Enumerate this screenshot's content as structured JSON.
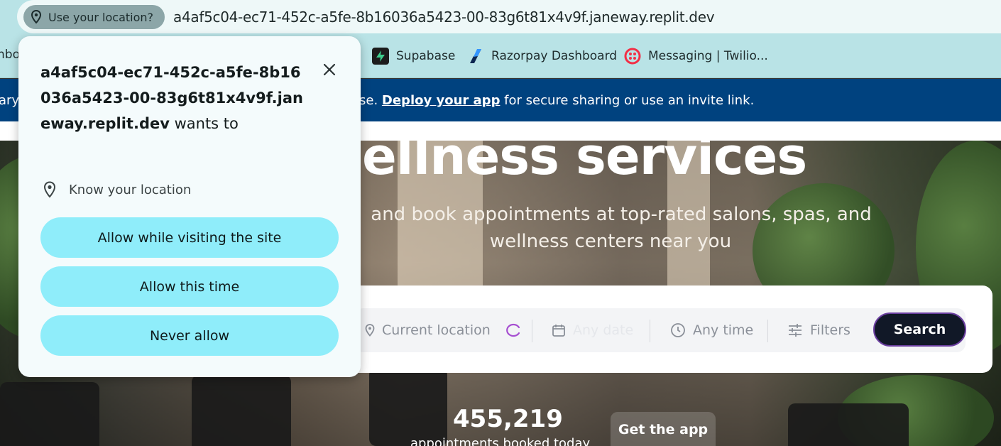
{
  "address_bar": {
    "location_chip_label": "Use your location?",
    "url": "a4af5c04-ec71-452c-a5fe-8b16036a5423-00-83g6t81x4v9f.janeway.replit.dev"
  },
  "bookmarks": {
    "cut_item": "nbo",
    "items": [
      {
        "label": "Supabase",
        "icon": "supabase-icon",
        "color": "#3ecf8e"
      },
      {
        "label": "Razorpay Dashboard",
        "icon": "razorpay-icon",
        "color": "#3395ff"
      },
      {
        "label": "Messaging | Twilio...",
        "icon": "twilio-icon",
        "color": "#f22f46"
      }
    ]
  },
  "banner": {
    "left_cut": "ary",
    "prefix": "se. ",
    "link": "Deploy your app",
    "suffix": " for secure sharing or use an invite link.",
    "color": "#00427f"
  },
  "hero": {
    "title": "ellness services",
    "subtitle_line1": "and book appointments at top-rated salons, spas, and",
    "subtitle_line2": "wellness centers near you",
    "search": {
      "location_placeholder": "Current location",
      "date_placeholder": "Any date",
      "time_placeholder": "Any time",
      "filters_label": "Filters",
      "search_button": "Search"
    },
    "stat_number": "455,219",
    "stat_label": "appointments booked today",
    "app_button": "Get the app"
  },
  "popup": {
    "site": "a4af5c04-ec71-452c-a5fe-8b16036a5423-00-83g6t81x4v9f.janeway.replit.dev",
    "wants_to": " wants to",
    "permission": "Know your location",
    "buttons": {
      "allow_visiting": "Allow while visiting the site",
      "allow_once": "Allow this time",
      "never": "Never allow"
    },
    "button_color": "#8fedfa"
  }
}
